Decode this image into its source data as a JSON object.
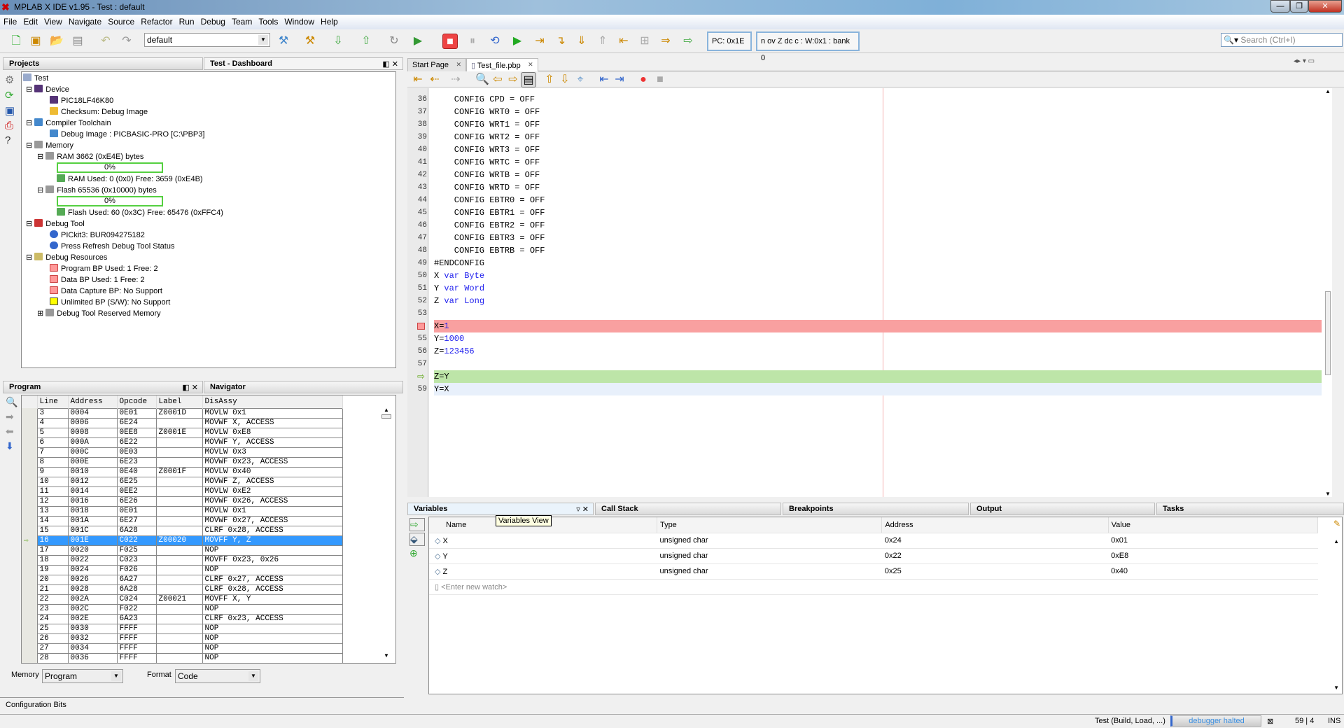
{
  "window": {
    "title": "MPLAB X IDE v1.95 - Test : default"
  },
  "menu": [
    "File",
    "Edit",
    "View",
    "Navigate",
    "Source",
    "Refactor",
    "Run",
    "Debug",
    "Team",
    "Tools",
    "Window",
    "Help"
  ],
  "toolbar": {
    "config": "default",
    "pc": "PC: 0x1E",
    "status_regs": "n ov Z dc c  : W:0x1 : bank 0",
    "search_placeholder": "Search (Ctrl+I)"
  },
  "projects": {
    "tab": "Projects",
    "dashboard_tab": "Test - Dashboard",
    "tree": {
      "root": "Test",
      "device": "Device",
      "device_name": "PIC18LF46K80",
      "checksum": "Checksum: Debug Image",
      "compiler": "Compiler Toolchain",
      "debug_image": "Debug Image : PICBASIC-PRO [C:\\PBP3]",
      "memory": "Memory",
      "ram": "RAM 3662 (0xE4E) bytes",
      "ram_pct": "0%",
      "ram_used": "RAM Used: 0 (0x0) Free: 3659 (0xE4B)",
      "flash": "Flash 65536 (0x10000) bytes",
      "flash_pct": "0%",
      "flash_used": "Flash Used: 60 (0x3C) Free: 65476 (0xFFC4)",
      "debug_tool": "Debug Tool",
      "pickit": "PICkit3: BUR094275182",
      "refresh": "Press Refresh Debug Tool Status",
      "debug_resources": "Debug Resources",
      "prog_bp": "Program BP Used: 1  Free: 2",
      "data_bp": "Data BP Used: 1  Free: 2",
      "data_capture": "Data Capture BP: No Support",
      "unlimited_bp": "Unlimited BP (S/W): No Support",
      "reserved": "Debug Tool Reserved Memory"
    },
    "ram_usage_percent": 0,
    "flash_usage_percent": 0
  },
  "program": {
    "tab": "Program",
    "navigator_tab": "Navigator",
    "columns": [
      "Line",
      "Address",
      "Opcode",
      "Label",
      "DisAssy"
    ],
    "rows": [
      [
        "3",
        "0004",
        "0E01",
        "Z0001D",
        "MOVLW 0x1"
      ],
      [
        "4",
        "0006",
        "6E24",
        "",
        "MOVWF X, ACCESS"
      ],
      [
        "5",
        "0008",
        "0EE8",
        "Z0001E",
        "MOVLW 0xE8"
      ],
      [
        "6",
        "000A",
        "6E22",
        "",
        "MOVWF Y, ACCESS"
      ],
      [
        "7",
        "000C",
        "0E03",
        "",
        "MOVLW 0x3"
      ],
      [
        "8",
        "000E",
        "6E23",
        "",
        "MOVWF 0x23, ACCESS"
      ],
      [
        "9",
        "0010",
        "0E40",
        "Z0001F",
        "MOVLW 0x40"
      ],
      [
        "10",
        "0012",
        "6E25",
        "",
        "MOVWF Z, ACCESS"
      ],
      [
        "11",
        "0014",
        "0EE2",
        "",
        "MOVLW 0xE2"
      ],
      [
        "12",
        "0016",
        "6E26",
        "",
        "MOVWF 0x26, ACCESS"
      ],
      [
        "13",
        "0018",
        "0E01",
        "",
        "MOVLW 0x1"
      ],
      [
        "14",
        "001A",
        "6E27",
        "",
        "MOVWF 0x27, ACCESS"
      ],
      [
        "15",
        "001C",
        "6A28",
        "",
        "CLRF 0x28, ACCESS"
      ],
      [
        "16",
        "001E",
        "C022",
        "Z00020",
        "MOVFF Y, Z"
      ],
      [
        "17",
        "0020",
        "F025",
        "",
        "NOP"
      ],
      [
        "18",
        "0022",
        "C023",
        "",
        "MOVFF 0x23, 0x26"
      ],
      [
        "19",
        "0024",
        "F026",
        "",
        "NOP"
      ],
      [
        "20",
        "0026",
        "6A27",
        "",
        "CLRF 0x27, ACCESS"
      ],
      [
        "21",
        "0028",
        "6A28",
        "",
        "CLRF 0x28, ACCESS"
      ],
      [
        "22",
        "002A",
        "C024",
        "Z00021",
        "MOVFF X, Y"
      ],
      [
        "23",
        "002C",
        "F022",
        "",
        "NOP"
      ],
      [
        "24",
        "002E",
        "6A23",
        "",
        "CLRF 0x23, ACCESS"
      ],
      [
        "25",
        "0030",
        "FFFF",
        "",
        "NOP"
      ],
      [
        "26",
        "0032",
        "FFFF",
        "",
        "NOP"
      ],
      [
        "27",
        "0034",
        "FFFF",
        "",
        "NOP"
      ],
      [
        "28",
        "0036",
        "FFFF",
        "",
        "NOP"
      ]
    ],
    "selected_line": "16",
    "memory_label": "Memory",
    "memory_value": "Program",
    "format_label": "Format",
    "format_value": "Code"
  },
  "config_bits": "Configuration Bits",
  "editor": {
    "tabs": [
      "Start Page",
      "Test_file.pbp"
    ],
    "active_tab": "Test_file.pbp",
    "lines": [
      {
        "n": "36",
        "t": "    CONFIG CPD = OFF"
      },
      {
        "n": "37",
        "t": "    CONFIG WRT0 = OFF"
      },
      {
        "n": "38",
        "t": "    CONFIG WRT1 = OFF"
      },
      {
        "n": "39",
        "t": "    CONFIG WRT2 = OFF"
      },
      {
        "n": "40",
        "t": "    CONFIG WRT3 = OFF"
      },
      {
        "n": "41",
        "t": "    CONFIG WRTC = OFF"
      },
      {
        "n": "42",
        "t": "    CONFIG WRTB = OFF"
      },
      {
        "n": "43",
        "t": "    CONFIG WRTD = OFF"
      },
      {
        "n": "44",
        "t": "    CONFIG EBTR0 = OFF"
      },
      {
        "n": "45",
        "t": "    CONFIG EBTR1 = OFF"
      },
      {
        "n": "46",
        "t": "    CONFIG EBTR2 = OFF"
      },
      {
        "n": "47",
        "t": "    CONFIG EBTR3 = OFF"
      },
      {
        "n": "48",
        "t": "    CONFIG EBTRB = OFF"
      },
      {
        "n": "49",
        "t": "#ENDCONFIG"
      },
      {
        "n": "50",
        "a": "X ",
        "k": "var Byte"
      },
      {
        "n": "51",
        "a": "Y ",
        "k": "var Word"
      },
      {
        "n": "52",
        "a": "Z ",
        "k": "var Long"
      },
      {
        "n": "53",
        "t": ""
      },
      {
        "n": "54",
        "a": "X=",
        "k": "1",
        "mark": "breakpoint"
      },
      {
        "n": "55",
        "a": "Y=",
        "k": "1000"
      },
      {
        "n": "56",
        "a": "Z=",
        "k": "123456"
      },
      {
        "n": "57",
        "t": ""
      },
      {
        "n": "58",
        "t": "Z=Y",
        "mark": "pc"
      },
      {
        "n": "59",
        "t": "Y=X",
        "mark": "current"
      }
    ],
    "colors": {
      "breakpoint": "#f9a0a0",
      "pc": "#bde5a8",
      "current": "#e8f0fb",
      "keyword": "#2222ee"
    }
  },
  "bottom": {
    "tabs": [
      "Variables",
      "Call Stack",
      "Breakpoints",
      "Output",
      "Tasks"
    ],
    "tooltip": "Variables View",
    "columns": [
      "Name",
      "Type",
      "Address",
      "Value"
    ],
    "rows": [
      [
        "X",
        "unsigned char",
        "0x24",
        "0x01"
      ],
      [
        "Y",
        "unsigned char",
        "0x22",
        "0xE8"
      ],
      [
        "Z",
        "unsigned char",
        "0x25",
        "0x40"
      ]
    ],
    "new_watch": "<Enter new watch>"
  },
  "status": {
    "task": "Test (Build, Load, ...)",
    "progress": "debugger halted",
    "position": "59 | 4",
    "mode": "INS"
  }
}
